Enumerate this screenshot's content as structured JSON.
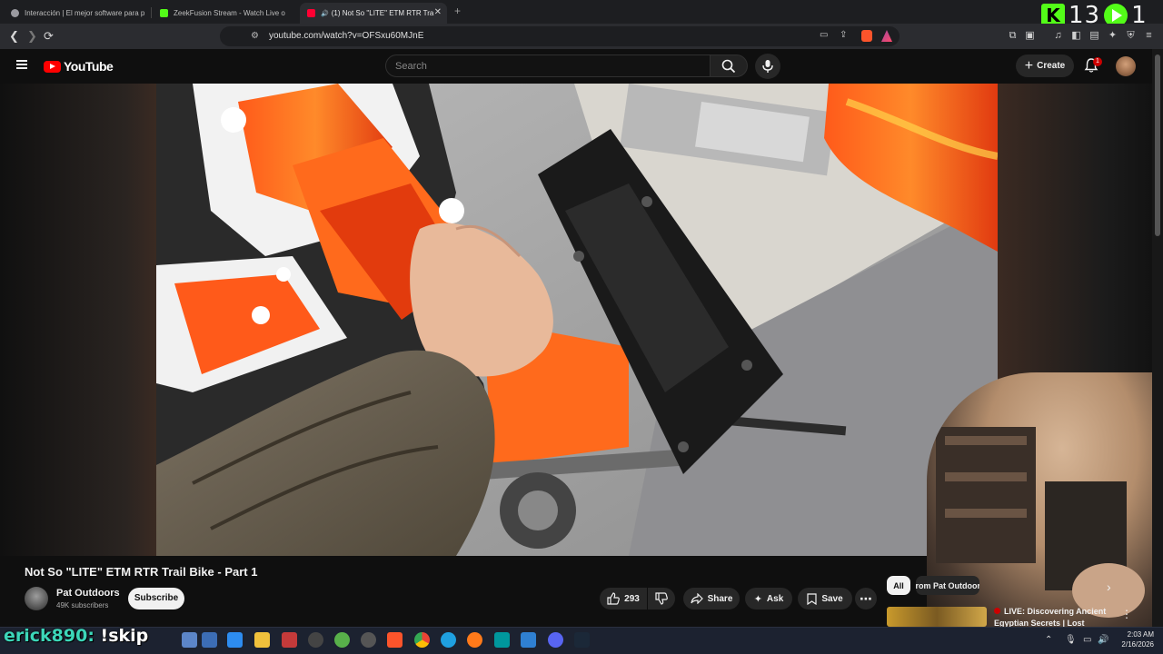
{
  "browser": {
    "tabs": [
      {
        "title": "Interacción | El mejor software para p",
        "favicon_color": "#9a9aa0",
        "active": false
      },
      {
        "title": "ZeekFusion Stream - Watch Live o",
        "favicon_color": "#53fc18",
        "active": false
      },
      {
        "title": "(1) Not So \"LITE\" ETM RTR Tra",
        "favicon_color": "#ff0033",
        "active": true
      }
    ],
    "new_tab": "+",
    "url": "youtube.com/watch?v=OFSxu60MJnE",
    "close_glyph": "✕"
  },
  "overlay": {
    "kick_logo": "K",
    "viewer_count": "13",
    "rumble_count": "1"
  },
  "youtube": {
    "logo_text": "YouTube",
    "search_placeholder": "Search",
    "create_label": "Create",
    "notification_count": "1",
    "video": {
      "title": "Not So \"LITE\" ETM RTR Trail Bike - Part 1",
      "channel_name": "Pat Outdoors",
      "subscribers": "49K subscribers",
      "subscribe_label": "Subscribe",
      "likes": "293",
      "share_label": "Share",
      "ask_label": "Ask",
      "save_label": "Save",
      "more_glyph": "⋯"
    },
    "chips": {
      "all": "All",
      "from": "From Pat Outdoors",
      "next": "›"
    },
    "recommendation": {
      "live_title": "LIVE: Discovering Ancient",
      "title_line2": "Egyptian Secrets | Lost",
      "more_glyph": "⋮"
    }
  },
  "stream_chat": {
    "username": "erick890:",
    "message": " !skip"
  },
  "taskbar": {
    "time": "2:03 AM",
    "date": "2/16/2026"
  },
  "colors": {
    "accent_red": "#ff0000",
    "kick_green": "#53fc18",
    "chat_user_color": "#3cd6b9"
  }
}
